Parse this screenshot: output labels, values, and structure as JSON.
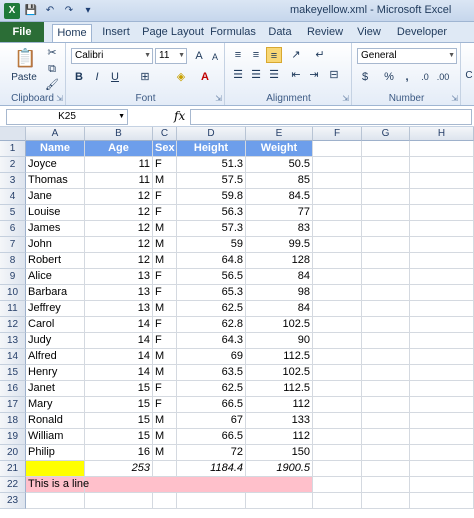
{
  "window": {
    "title": "makeyellow.xml - Microsoft Excel"
  },
  "qat": {
    "app_icon": "X",
    "save": "💾",
    "undo": "↶",
    "redo": "↷",
    "customize": "▾"
  },
  "tabs": [
    "File",
    "Home",
    "Insert",
    "Page Layout",
    "Formulas",
    "Data",
    "Review",
    "View",
    "Developer"
  ],
  "ribbon": {
    "clipboard": {
      "label": "Clipboard",
      "paste": "Paste"
    },
    "font": {
      "label": "Font",
      "family": "Calibri",
      "size": "11",
      "bold": "B",
      "italic": "I",
      "underline": "U"
    },
    "alignment": {
      "label": "Alignment"
    },
    "number": {
      "label": "Number",
      "format": "General",
      "currency": "$",
      "percent": "%",
      "comma": ","
    },
    "styles": {
      "partial": "C"
    }
  },
  "formula_bar": {
    "name_box": "K25",
    "fx": "fx",
    "value": ""
  },
  "columns": [
    "A",
    "B",
    "C",
    "D",
    "E",
    "F",
    "G",
    "H"
  ],
  "rows": [
    "1",
    "2",
    "3",
    "4",
    "5",
    "6",
    "7",
    "8",
    "9",
    "10",
    "11",
    "12",
    "13",
    "14",
    "15",
    "16",
    "17",
    "18",
    "19",
    "20",
    "21",
    "22",
    "23"
  ],
  "sheet": {
    "header": [
      "Name",
      "Age",
      "Sex",
      "Height",
      "Weight"
    ],
    "data": [
      [
        "Joyce",
        "11",
        "F",
        "51.3",
        "50.5"
      ],
      [
        "Thomas",
        "11",
        "M",
        "57.5",
        "85"
      ],
      [
        "Jane",
        "12",
        "F",
        "59.8",
        "84.5"
      ],
      [
        "Louise",
        "12",
        "F",
        "56.3",
        "77"
      ],
      [
        "James",
        "12",
        "M",
        "57.3",
        "83"
      ],
      [
        "John",
        "12",
        "M",
        "59",
        "99.5"
      ],
      [
        "Robert",
        "12",
        "M",
        "64.8",
        "128"
      ],
      [
        "Alice",
        "13",
        "F",
        "56.5",
        "84"
      ],
      [
        "Barbara",
        "13",
        "F",
        "65.3",
        "98"
      ],
      [
        "Jeffrey",
        "13",
        "M",
        "62.5",
        "84"
      ],
      [
        "Carol",
        "14",
        "F",
        "62.8",
        "102.5"
      ],
      [
        "Judy",
        "14",
        "F",
        "64.3",
        "90"
      ],
      [
        "Alfred",
        "14",
        "M",
        "69",
        "112.5"
      ],
      [
        "Henry",
        "14",
        "M",
        "63.5",
        "102.5"
      ],
      [
        "Janet",
        "15",
        "F",
        "62.5",
        "112.5"
      ],
      [
        "Mary",
        "15",
        "F",
        "66.5",
        "112"
      ],
      [
        "Ronald",
        "15",
        "M",
        "67",
        "133"
      ],
      [
        "William",
        "15",
        "M",
        "66.5",
        "112"
      ],
      [
        "Philip",
        "16",
        "M",
        "72",
        "150"
      ]
    ],
    "totals": [
      "",
      "253",
      "",
      "1184.4",
      "1900.5"
    ],
    "line_text": "This is a line"
  },
  "colors": {
    "header_fill": "#6d9eeb",
    "total_name_fill": "#ffff00",
    "line_fill": "#ffc0cb"
  }
}
